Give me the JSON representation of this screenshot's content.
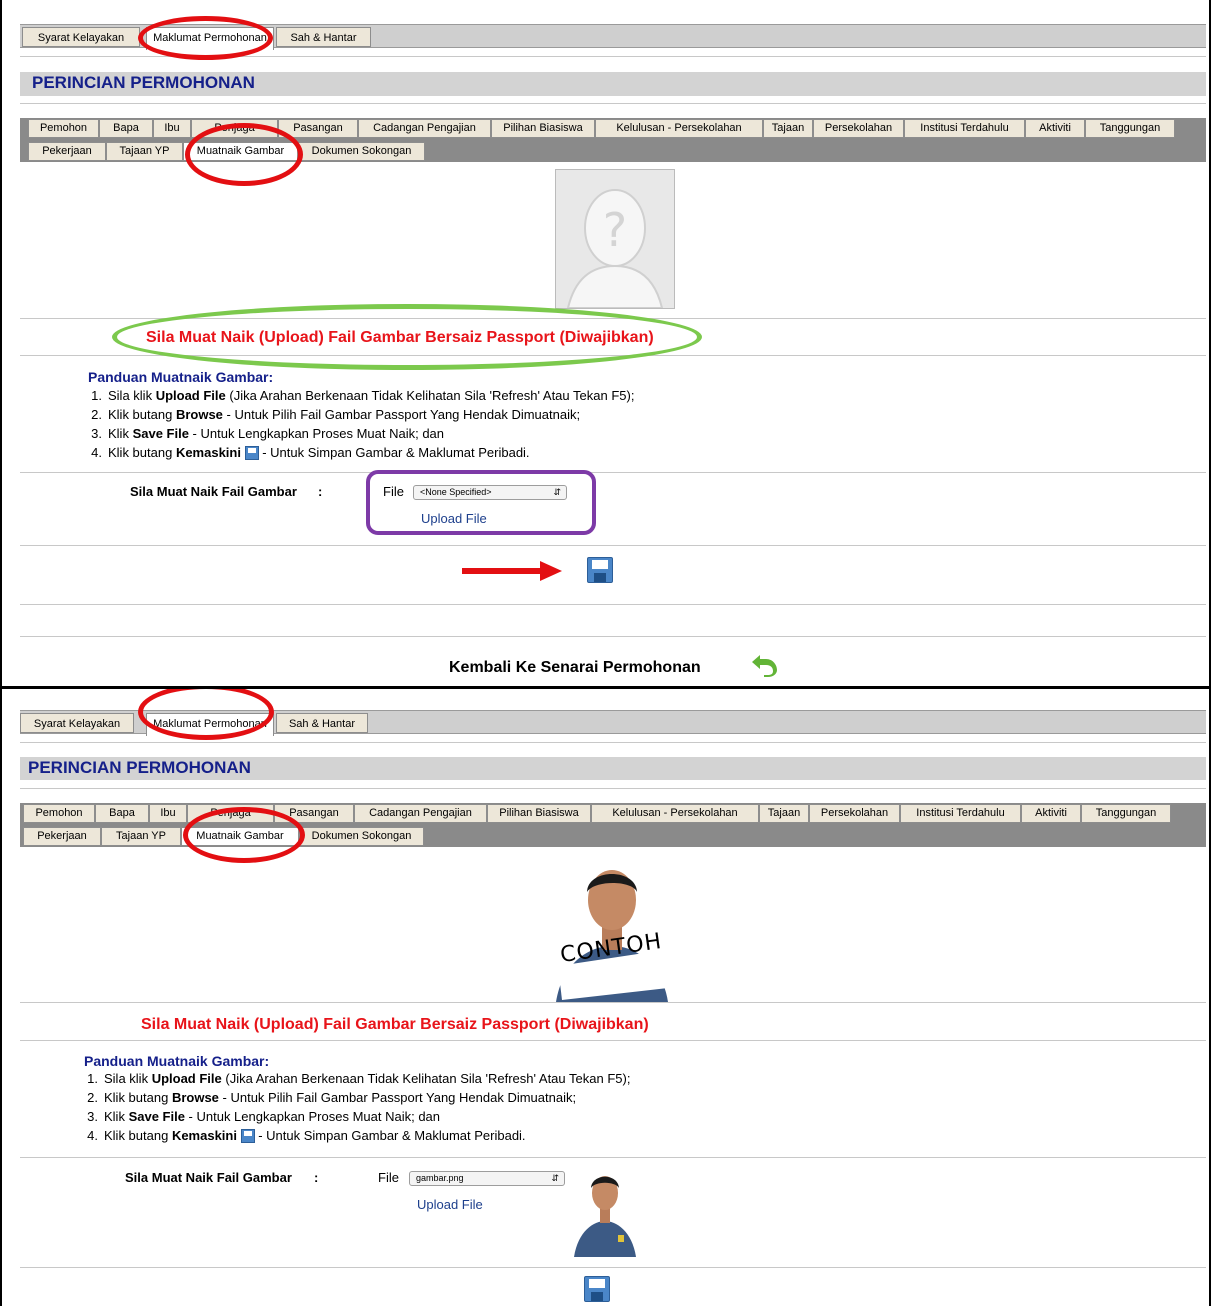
{
  "top_tabs": [
    "Syarat Kelayakan",
    "Maklumat Permohonan",
    "Sah & Hantar"
  ],
  "page_title": "PERINCIAN PERMOHONAN",
  "sub_tabs_row1": [
    "Pemohon",
    "Bapa",
    "Ibu",
    "Penjaga",
    "Pasangan",
    "Cadangan Pengajian",
    "Pilihan Biasiswa",
    "Kelulusan - Persekolahan",
    "Tajaan",
    "Persekolahan",
    "Institusi Terdahulu",
    "Aktiviti",
    "Tanggungan"
  ],
  "sub_tabs_row2": [
    "Pekerjaan",
    "Tajaan YP",
    "Muatnaik Gambar",
    "Dokumen Sokongan"
  ],
  "notice": "Sila Muat Naik (Upload) Fail Gambar Bersaiz Passport (Diwajibkan)",
  "guide": {
    "heading": "Panduan Muatnaik Gambar:",
    "steps": [
      {
        "num": "1.",
        "pre": "Sila klik ",
        "bold": "Upload File",
        "post": " (Jika Arahan Berkenaan Tidak Kelihatan Sila 'Refresh' Atau Tekan F5);"
      },
      {
        "num": "2.",
        "pre": "Klik butang ",
        "bold": "Browse",
        "post": " - Untuk Pilih Fail Gambar Passport Yang Hendak Dimuatnaik;"
      },
      {
        "num": "3.",
        "pre": "Klik ",
        "bold": "Save File",
        "post": " - Untuk Lengkapkan Proses Muat Naik; dan"
      },
      {
        "num": "4.",
        "pre": "Klik butang ",
        "bold": "Kemaskini",
        "post": " - Untuk Simpan Gambar & Maklumat Peribadi."
      }
    ]
  },
  "upload": {
    "label": "Sila Muat Naik Fail Gambar",
    "colon": ":",
    "file_label": "File",
    "file_value_before": "<None Specified>",
    "file_value_after": "gambar.png",
    "upload_link": "Upload File"
  },
  "sample_stamp": "CONTOH",
  "back_link": "Kembali Ke Senarai Permohonan",
  "colors": {
    "title_blue": "#15208a",
    "notice_red": "#e8141a",
    "annot_red": "#e30f12",
    "annot_green": "#7cc94d",
    "annot_purple": "#7d3aa7"
  }
}
